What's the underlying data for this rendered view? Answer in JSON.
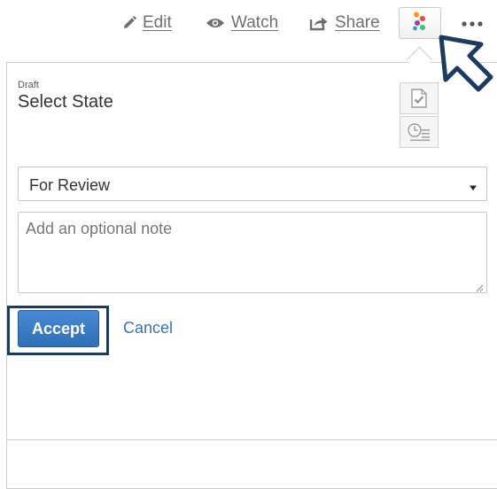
{
  "toolbar": {
    "edit_label": "Edit",
    "watch_label": "Watch",
    "share_label": "Share",
    "icons": {
      "edit": "pencil-icon",
      "watch": "eye-icon",
      "share": "share-icon",
      "workflow": "workflow-icon",
      "more": "more-icon"
    }
  },
  "panel": {
    "current_state": "Draft",
    "title": "Select State",
    "state_select": {
      "selected": "For Review"
    },
    "note": {
      "placeholder": "Add an optional note",
      "value": ""
    },
    "accept_label": "Accept",
    "cancel_label": "Cancel",
    "side_icons": [
      "approve-icon",
      "history-icon"
    ]
  },
  "colors": {
    "accent": "#2f6fb8",
    "link": "#3b73af",
    "highlight_frame": "#1d3a5f",
    "toolbar_text": "#707070"
  }
}
